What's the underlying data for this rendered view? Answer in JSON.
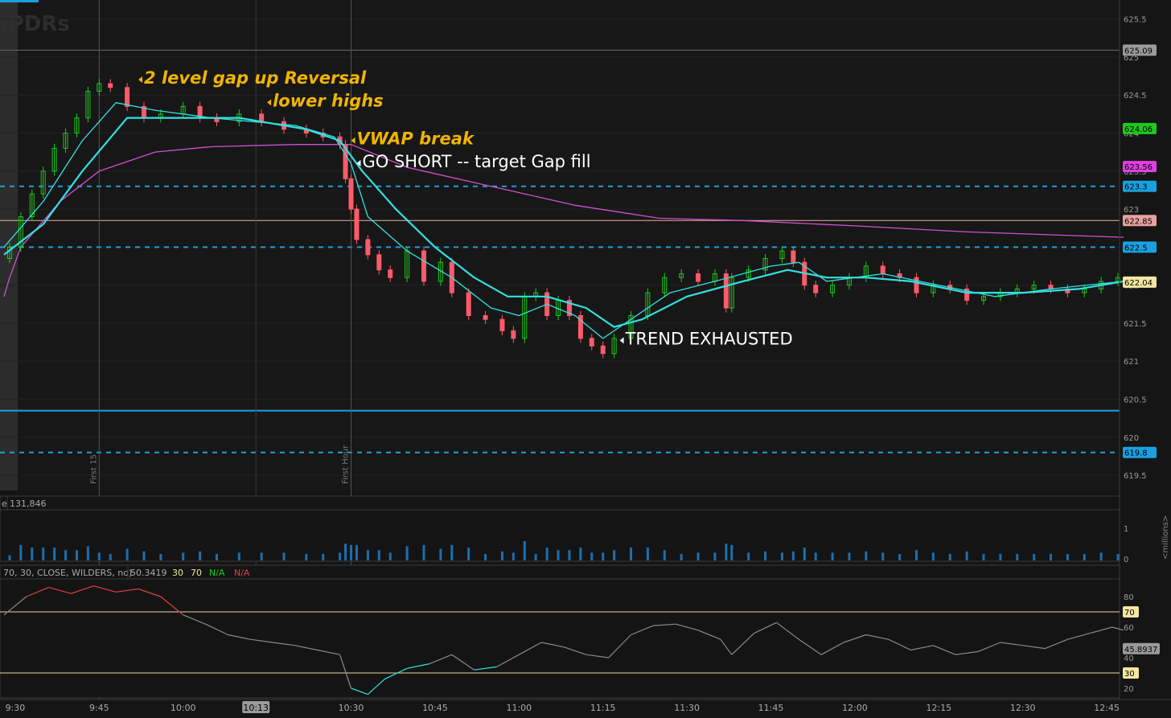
{
  "chart_data": {
    "type": "candlestick",
    "symbol_watermark": "SPDRs",
    "price_axis": {
      "ticks": [
        "625.5",
        "625",
        "624.5",
        "624",
        "623.5",
        "623",
        "622.5",
        "622",
        "621.5",
        "621",
        "620.5",
        "620",
        "619.5"
      ],
      "ylim": [
        619.3,
        625.75
      ]
    },
    "price_tags": [
      {
        "label": "625.09",
        "value": 625.09,
        "color": "#9a9a9a",
        "text_color": "#000000"
      },
      {
        "label": "624.06",
        "value": 624.06,
        "color": "#1ec81e",
        "text_color": "#000000"
      },
      {
        "label": "623.56",
        "value": 623.56,
        "color": "#e040e0",
        "text_color": "#000000"
      },
      {
        "label": "623.3",
        "value": 623.3,
        "color": "#1aa0e0",
        "text_color": "#000000"
      },
      {
        "label": "622.85",
        "value": 622.85,
        "color": "#e8a0a0",
        "text_color": "#000000"
      },
      {
        "label": "622.5",
        "value": 622.5,
        "color": "#1aa0e0",
        "text_color": "#000000"
      },
      {
        "label": "622.04",
        "value": 622.04,
        "color": "#f5e6a0",
        "text_color": "#000000"
      },
      {
        "label": "619.8",
        "value": 619.8,
        "color": "#1aa0e0",
        "text_color": "#000000"
      }
    ],
    "horizontal_levels": [
      {
        "value": 625.09,
        "style": "solid",
        "color": "#6a6a6a"
      },
      {
        "value": 623.3,
        "style": "dashed",
        "color": "#1aa0e0"
      },
      {
        "value": 622.85,
        "style": "solid",
        "color": "#e8b0a0"
      },
      {
        "value": 622.5,
        "style": "dashed",
        "color": "#1aa0e0"
      },
      {
        "value": 620.35,
        "style": "solid",
        "color": "#1aa0e0"
      },
      {
        "value": 619.8,
        "style": "dashed",
        "color": "#1aa0e0"
      }
    ],
    "vertical_markers": [
      "First 15",
      "First Hour"
    ],
    "time_ticks": [
      "9:30",
      "9:45",
      "10:00",
      "10:13",
      "10:30",
      "10:45",
      "11:00",
      "11:15",
      "11:30",
      "11:45",
      "12:00",
      "12:15",
      "12:30",
      "12:45"
    ],
    "time_range": [
      "09:28",
      "12:48"
    ],
    "closes": [
      {
        "t": "09:29",
        "v": 622.5
      },
      {
        "t": "09:31",
        "v": 622.9
      },
      {
        "t": "09:33",
        "v": 623.2
      },
      {
        "t": "09:35",
        "v": 623.5
      },
      {
        "t": "09:37",
        "v": 623.8
      },
      {
        "t": "09:39",
        "v": 624.0
      },
      {
        "t": "09:41",
        "v": 624.2
      },
      {
        "t": "09:43",
        "v": 624.55
      },
      {
        "t": "09:45",
        "v": 624.65
      },
      {
        "t": "09:47",
        "v": 624.6
      },
      {
        "t": "09:50",
        "v": 624.35
      },
      {
        "t": "09:53",
        "v": 624.2
      },
      {
        "t": "09:56",
        "v": 624.25
      },
      {
        "t": "10:00",
        "v": 624.35
      },
      {
        "t": "10:03",
        "v": 624.2
      },
      {
        "t": "10:06",
        "v": 624.15
      },
      {
        "t": "10:10",
        "v": 624.25
      },
      {
        "t": "10:14",
        "v": 624.15
      },
      {
        "t": "10:18",
        "v": 624.05
      },
      {
        "t": "10:22",
        "v": 624.0
      },
      {
        "t": "10:25",
        "v": 623.95
      },
      {
        "t": "10:28",
        "v": 623.85
      },
      {
        "t": "10:29",
        "v": 623.4
      },
      {
        "t": "10:30",
        "v": 623.0
      },
      {
        "t": "10:31",
        "v": 622.6
      },
      {
        "t": "10:33",
        "v": 622.4
      },
      {
        "t": "10:35",
        "v": 622.2
      },
      {
        "t": "10:37",
        "v": 622.1
      },
      {
        "t": "10:40",
        "v": 622.45
      },
      {
        "t": "10:43",
        "v": 622.05
      },
      {
        "t": "10:46",
        "v": 622.3
      },
      {
        "t": "10:48",
        "v": 621.9
      },
      {
        "t": "10:51",
        "v": 621.6
      },
      {
        "t": "10:54",
        "v": 621.55
      },
      {
        "t": "10:57",
        "v": 621.4
      },
      {
        "t": "10:59",
        "v": 621.3
      },
      {
        "t": "11:01",
        "v": 621.85
      },
      {
        "t": "11:03",
        "v": 621.9
      },
      {
        "t": "11:05",
        "v": 621.6
      },
      {
        "t": "11:07",
        "v": 621.8
      },
      {
        "t": "11:09",
        "v": 621.6
      },
      {
        "t": "11:11",
        "v": 621.3
      },
      {
        "t": "11:13",
        "v": 621.2
      },
      {
        "t": "11:15",
        "v": 621.1
      },
      {
        "t": "11:17",
        "v": 621.3
      },
      {
        "t": "11:20",
        "v": 621.6
      },
      {
        "t": "11:23",
        "v": 621.9
      },
      {
        "t": "11:26",
        "v": 622.1
      },
      {
        "t": "11:29",
        "v": 622.15
      },
      {
        "t": "11:32",
        "v": 622.05
      },
      {
        "t": "11:35",
        "v": 622.15
      },
      {
        "t": "11:37",
        "v": 621.7
      },
      {
        "t": "11:38",
        "v": 622.1
      },
      {
        "t": "11:41",
        "v": 622.2
      },
      {
        "t": "11:44",
        "v": 622.35
      },
      {
        "t": "11:47",
        "v": 622.45
      },
      {
        "t": "11:49",
        "v": 622.3
      },
      {
        "t": "11:51",
        "v": 622.0
      },
      {
        "t": "11:53",
        "v": 621.9
      },
      {
        "t": "11:56",
        "v": 622.0
      },
      {
        "t": "11:59",
        "v": 622.1
      },
      {
        "t": "12:02",
        "v": 622.25
      },
      {
        "t": "12:05",
        "v": 622.15
      },
      {
        "t": "12:08",
        "v": 622.1
      },
      {
        "t": "12:11",
        "v": 621.9
      },
      {
        "t": "12:14",
        "v": 622.0
      },
      {
        "t": "12:17",
        "v": 621.95
      },
      {
        "t": "12:20",
        "v": 621.8
      },
      {
        "t": "12:23",
        "v": 621.85
      },
      {
        "t": "12:26",
        "v": 621.9
      },
      {
        "t": "12:29",
        "v": 621.95
      },
      {
        "t": "12:32",
        "v": 622.0
      },
      {
        "t": "12:35",
        "v": 621.95
      },
      {
        "t": "12:38",
        "v": 621.9
      },
      {
        "t": "12:41",
        "v": 621.95
      },
      {
        "t": "12:44",
        "v": 622.05
      },
      {
        "t": "12:47",
        "v": 622.1
      }
    ],
    "ema_fast": [
      {
        "t": "09:28",
        "v": 622.5
      },
      {
        "t": "09:35",
        "v": 623.1
      },
      {
        "t": "09:42",
        "v": 623.9
      },
      {
        "t": "09:48",
        "v": 624.4
      },
      {
        "t": "09:55",
        "v": 624.3
      },
      {
        "t": "10:05",
        "v": 624.2
      },
      {
        "t": "10:20",
        "v": 624.1
      },
      {
        "t": "10:27",
        "v": 623.95
      },
      {
        "t": "10:30",
        "v": 623.6
      },
      {
        "t": "10:33",
        "v": 622.9
      },
      {
        "t": "10:40",
        "v": 622.45
      },
      {
        "t": "10:48",
        "v": 622.1
      },
      {
        "t": "10:55",
        "v": 621.7
      },
      {
        "t": "11:00",
        "v": 621.6
      },
      {
        "t": "11:05",
        "v": 621.75
      },
      {
        "t": "11:10",
        "v": 621.6
      },
      {
        "t": "11:15",
        "v": 621.3
      },
      {
        "t": "11:20",
        "v": 621.55
      },
      {
        "t": "11:27",
        "v": 621.9
      },
      {
        "t": "11:35",
        "v": 622.05
      },
      {
        "t": "11:45",
        "v": 622.25
      },
      {
        "t": "11:50",
        "v": 622.3
      },
      {
        "t": "11:55",
        "v": 622.05
      },
      {
        "t": "12:00",
        "v": 622.1
      },
      {
        "t": "12:05",
        "v": 622.15
      },
      {
        "t": "12:15",
        "v": 622.0
      },
      {
        "t": "12:25",
        "v": 621.85
      },
      {
        "t": "12:35",
        "v": 621.95
      },
      {
        "t": "12:48",
        "v": 622.05
      }
    ],
    "ema_slow": [
      {
        "t": "09:28",
        "v": 622.4
      },
      {
        "t": "09:35",
        "v": 622.8
      },
      {
        "t": "09:42",
        "v": 623.5
      },
      {
        "t": "09:50",
        "v": 624.2
      },
      {
        "t": "09:58",
        "v": 624.2
      },
      {
        "t": "10:10",
        "v": 624.2
      },
      {
        "t": "10:22",
        "v": 624.05
      },
      {
        "t": "10:28",
        "v": 623.9
      },
      {
        "t": "10:32",
        "v": 623.5
      },
      {
        "t": "10:38",
        "v": 623.0
      },
      {
        "t": "10:45",
        "v": 622.5
      },
      {
        "t": "10:52",
        "v": 622.1
      },
      {
        "t": "10:58",
        "v": 621.85
      },
      {
        "t": "11:05",
        "v": 621.85
      },
      {
        "t": "11:12",
        "v": 621.7
      },
      {
        "t": "11:17",
        "v": 621.45
      },
      {
        "t": "11:22",
        "v": 621.55
      },
      {
        "t": "11:30",
        "v": 621.85
      },
      {
        "t": "11:40",
        "v": 622.05
      },
      {
        "t": "11:48",
        "v": 622.2
      },
      {
        "t": "11:55",
        "v": 622.1
      },
      {
        "t": "12:02",
        "v": 622.1
      },
      {
        "t": "12:10",
        "v": 622.05
      },
      {
        "t": "12:20",
        "v": 621.9
      },
      {
        "t": "12:30",
        "v": 621.9
      },
      {
        "t": "12:40",
        "v": 621.95
      },
      {
        "t": "12:48",
        "v": 622.05
      }
    ],
    "vwap": [
      {
        "t": "09:28",
        "v": 621.85
      },
      {
        "t": "09:29",
        "v": 622.1
      },
      {
        "t": "09:31",
        "v": 622.5
      },
      {
        "t": "09:38",
        "v": 623.1
      },
      {
        "t": "09:45",
        "v": 623.5
      },
      {
        "t": "09:55",
        "v": 623.75
      },
      {
        "t": "10:05",
        "v": 623.82
      },
      {
        "t": "10:20",
        "v": 623.85
      },
      {
        "t": "10:30",
        "v": 623.85
      },
      {
        "t": "10:40",
        "v": 623.55
      },
      {
        "t": "10:55",
        "v": 623.3
      },
      {
        "t": "11:10",
        "v": 623.05
      },
      {
        "t": "11:25",
        "v": 622.88
      },
      {
        "t": "11:40",
        "v": 622.85
      },
      {
        "t": "12:00",
        "v": 622.78
      },
      {
        "t": "12:20",
        "v": 622.7
      },
      {
        "t": "12:48",
        "v": 622.63
      }
    ],
    "volume_label": "131,846",
    "volume_unit": "<millions>",
    "volume_ticks": [
      "1",
      "0"
    ],
    "rsi_legend": {
      "params": "70, 30, CLOSE, WILDERS, no)",
      "value": "50.3419",
      "ob": "30",
      "os": "70",
      "na1": "N/A",
      "na2": "N/A"
    },
    "rsi_ticks": [
      "80",
      "60",
      "40",
      "20"
    ],
    "rsi_levels": [
      {
        "label": "70",
        "value": 70
      },
      {
        "label": "30",
        "value": 30
      }
    ],
    "rsi_tag": {
      "label": "45.8937",
      "value": 45.9
    },
    "rsi": [
      {
        "t": "09:28",
        "v": 68
      },
      {
        "t": "09:32",
        "v": 80
      },
      {
        "t": "09:36",
        "v": 86
      },
      {
        "t": "09:40",
        "v": 82
      },
      {
        "t": "09:44",
        "v": 87
      },
      {
        "t": "09:48",
        "v": 83
      },
      {
        "t": "09:52",
        "v": 85
      },
      {
        "t": "09:56",
        "v": 80
      },
      {
        "t": "10:00",
        "v": 68
      },
      {
        "t": "10:04",
        "v": 62
      },
      {
        "t": "10:08",
        "v": 55
      },
      {
        "t": "10:12",
        "v": 52
      },
      {
        "t": "10:16",
        "v": 50
      },
      {
        "t": "10:20",
        "v": 48
      },
      {
        "t": "10:24",
        "v": 45
      },
      {
        "t": "10:28",
        "v": 42
      },
      {
        "t": "10:30",
        "v": 20
      },
      {
        "t": "10:33",
        "v": 16
      },
      {
        "t": "10:36",
        "v": 26
      },
      {
        "t": "10:40",
        "v": 33
      },
      {
        "t": "10:44",
        "v": 36
      },
      {
        "t": "10:48",
        "v": 42
      },
      {
        "t": "10:52",
        "v": 32
      },
      {
        "t": "10:56",
        "v": 34
      },
      {
        "t": "11:00",
        "v": 42
      },
      {
        "t": "11:04",
        "v": 50
      },
      {
        "t": "11:08",
        "v": 47
      },
      {
        "t": "11:12",
        "v": 42
      },
      {
        "t": "11:16",
        "v": 40
      },
      {
        "t": "11:20",
        "v": 55
      },
      {
        "t": "11:24",
        "v": 61
      },
      {
        "t": "11:28",
        "v": 62
      },
      {
        "t": "11:32",
        "v": 58
      },
      {
        "t": "11:36",
        "v": 52
      },
      {
        "t": "11:38",
        "v": 42
      },
      {
        "t": "11:42",
        "v": 56
      },
      {
        "t": "11:46",
        "v": 63
      },
      {
        "t": "11:50",
        "v": 52
      },
      {
        "t": "11:54",
        "v": 42
      },
      {
        "t": "11:58",
        "v": 50
      },
      {
        "t": "12:02",
        "v": 55
      },
      {
        "t": "12:06",
        "v": 52
      },
      {
        "t": "12:10",
        "v": 45
      },
      {
        "t": "12:14",
        "v": 48
      },
      {
        "t": "12:18",
        "v": 42
      },
      {
        "t": "12:22",
        "v": 44
      },
      {
        "t": "12:26",
        "v": 50
      },
      {
        "t": "12:30",
        "v": 48
      },
      {
        "t": "12:34",
        "v": 46
      },
      {
        "t": "12:38",
        "v": 52
      },
      {
        "t": "12:42",
        "v": 56
      },
      {
        "t": "12:46",
        "v": 60
      },
      {
        "t": "12:48",
        "v": 58
      }
    ],
    "annotations": [
      {
        "text": "2 level gap up Reversal",
        "t": "09:52",
        "v": 624.65,
        "style": "bold-italic",
        "color": "#f0b400"
      },
      {
        "text": "lower highs",
        "t": "10:15",
        "v": 624.35,
        "style": "bold-italic",
        "color": "#f0b400"
      },
      {
        "text": "VWAP break",
        "t": "10:30",
        "v": 623.85,
        "style": "bold-italic",
        "color": "#f0b400"
      },
      {
        "text": "GO SHORT -- target Gap fill",
        "t": "10:31",
        "v": 623.55,
        "style": "normal",
        "color": "#ffffff"
      },
      {
        "text": "TREND EXHAUSTED",
        "t": "11:18",
        "v": 621.22,
        "style": "normal",
        "color": "#ffffff"
      }
    ]
  },
  "colors": {
    "up_candle": "#1ec81e",
    "down_candle": "#ff5a6a",
    "ema": "#33e0e0",
    "vwap": "#d050d0",
    "volume": "#1a6fb0",
    "rsi": "#8a8a8a",
    "rsi_overbought": "#e04040"
  }
}
